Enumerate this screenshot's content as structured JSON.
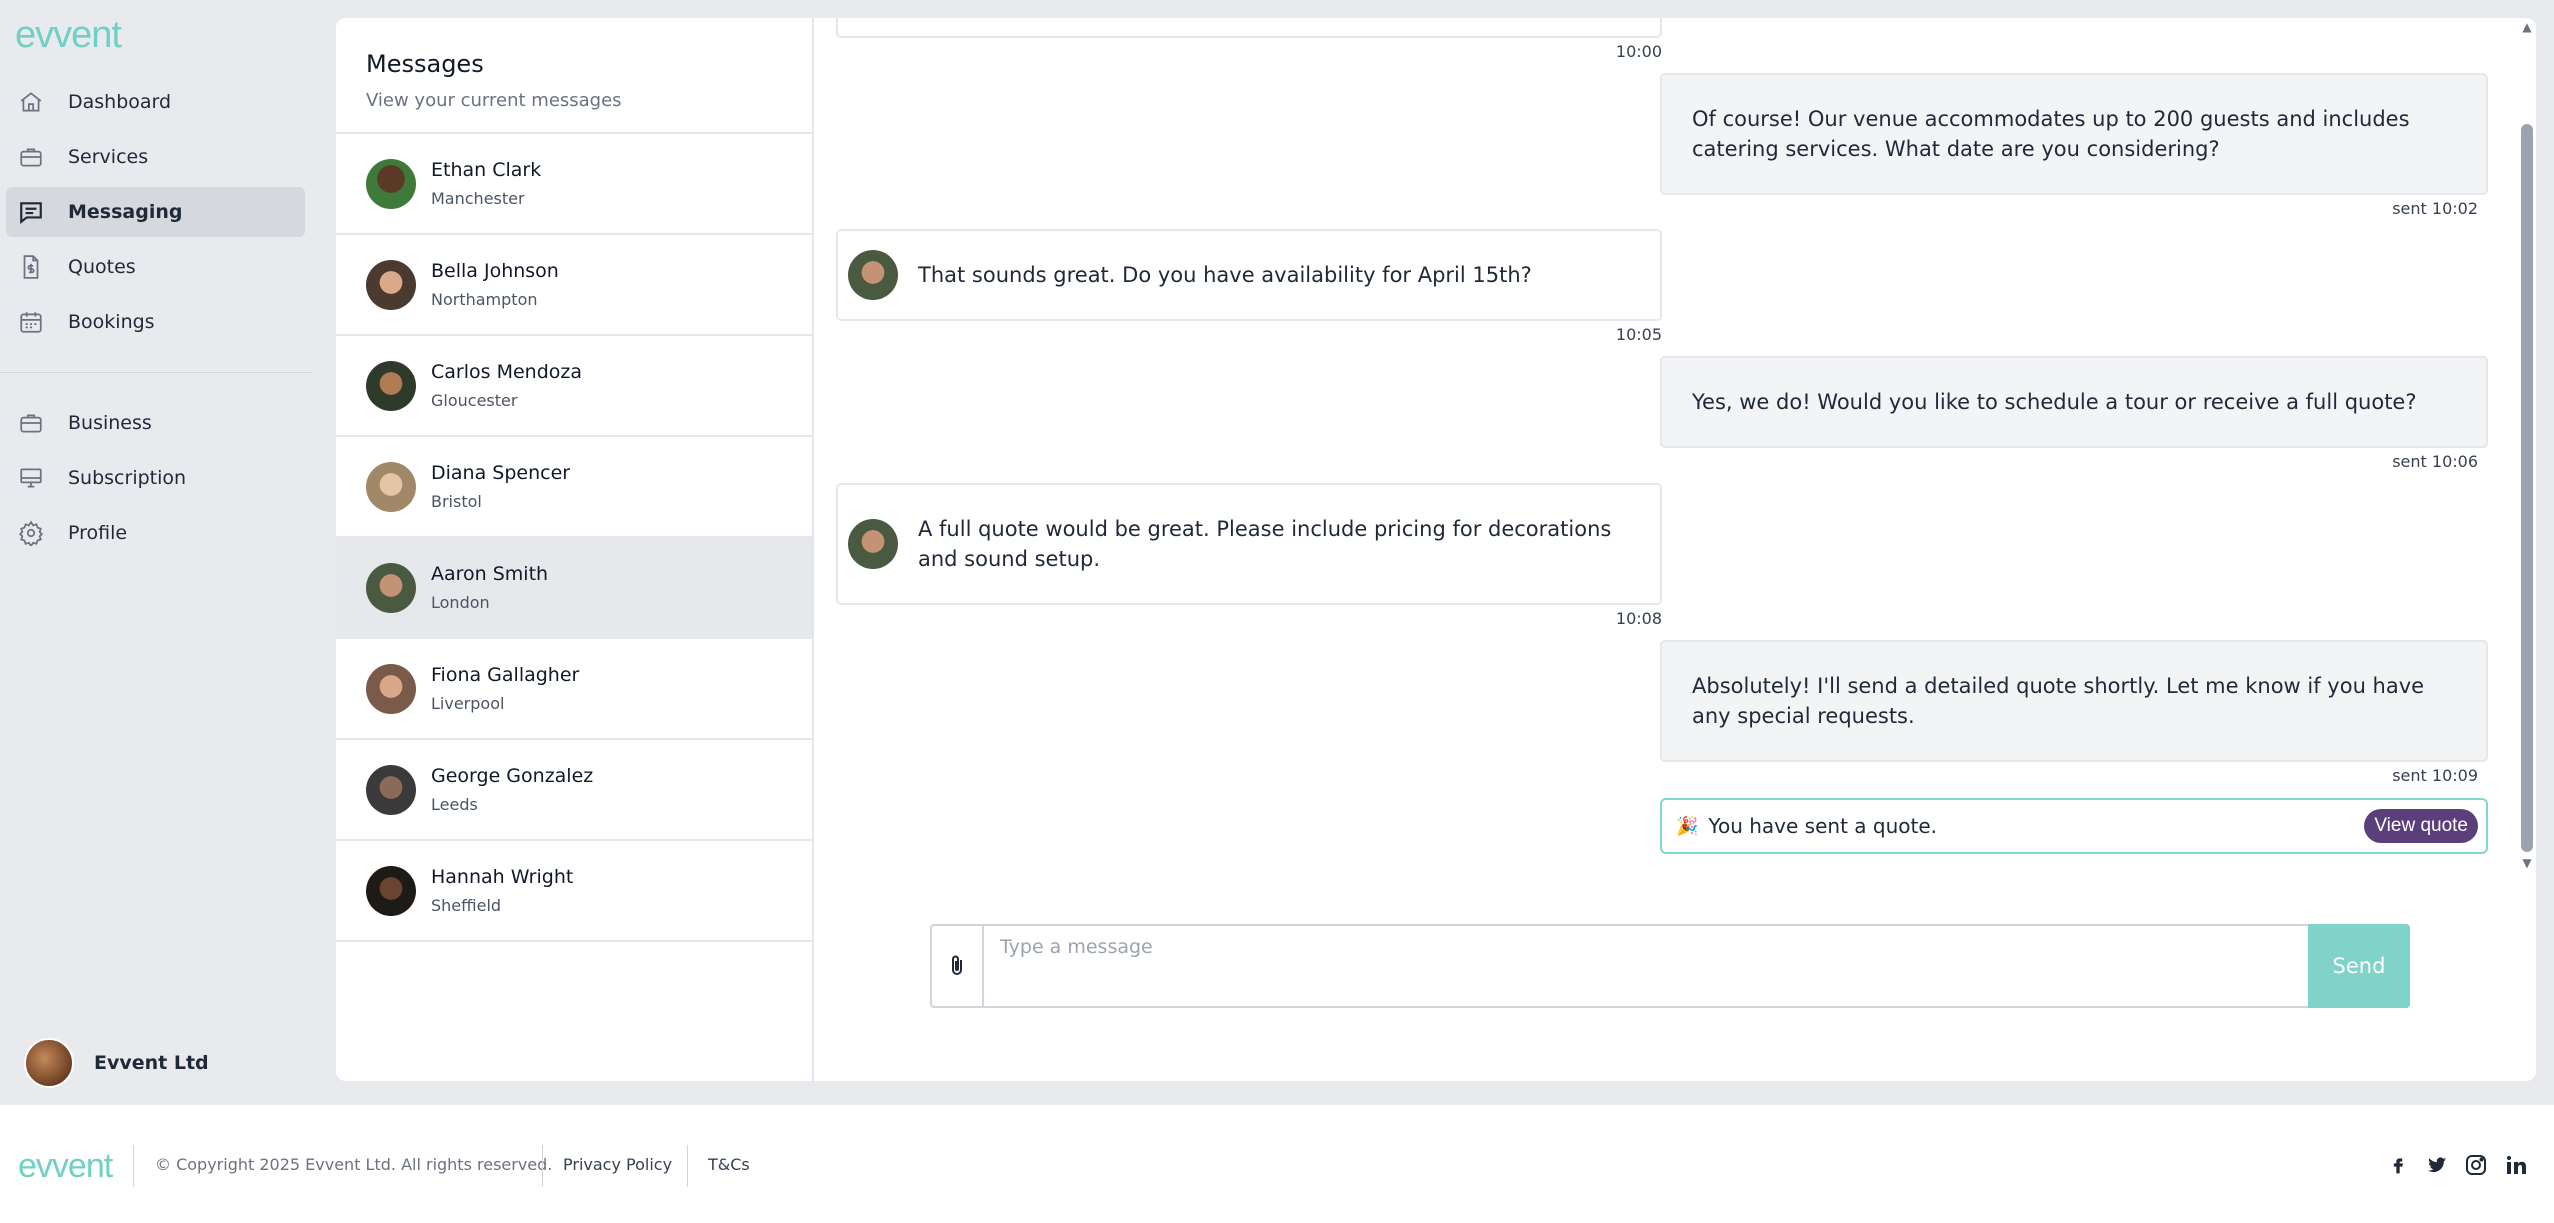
{
  "app": {
    "logo": "evvent"
  },
  "sidebar": {
    "items": [
      {
        "label": "Dashboard",
        "icon": "home-icon"
      },
      {
        "label": "Services",
        "icon": "briefcase-icon"
      },
      {
        "label": "Messaging",
        "icon": "message-icon",
        "active": true
      },
      {
        "label": "Quotes",
        "icon": "document-dollar-icon"
      },
      {
        "label": "Bookings",
        "icon": "calendar-icon"
      },
      {
        "label": "Business",
        "icon": "briefcase-icon"
      },
      {
        "label": "Subscription",
        "icon": "monitor-icon"
      },
      {
        "label": "Profile",
        "icon": "gear-icon"
      }
    ],
    "account_name": "Evvent Ltd"
  },
  "messages_panel": {
    "title": "Messages",
    "subtitle": "View your current messages",
    "conversations": [
      {
        "name": "Ethan Clark",
        "city": "Manchester"
      },
      {
        "name": "Bella Johnson",
        "city": "Northampton"
      },
      {
        "name": "Carlos Mendoza",
        "city": "Gloucester"
      },
      {
        "name": "Diana Spencer",
        "city": "Bristol"
      },
      {
        "name": "Aaron Smith",
        "city": "London",
        "active": true
      },
      {
        "name": "Fiona Gallagher",
        "city": "Liverpool"
      },
      {
        "name": "George Gonzalez",
        "city": "Leeds"
      },
      {
        "name": "Hannah Wright",
        "city": "Sheffield"
      }
    ]
  },
  "chat": {
    "messages": [
      {
        "text": "",
        "time": "10:00",
        "direction": "in"
      },
      {
        "text": "Of course! Our venue accommodates up to 200 guests and includes catering services. What date are you considering?",
        "time": "sent 10:02",
        "direction": "out"
      },
      {
        "text": "That sounds great. Do you have availability for April 15th?",
        "time": "10:05",
        "direction": "in"
      },
      {
        "text": "Yes, we do! Would you like to schedule a tour or receive a full quote?",
        "time": "sent 10:06",
        "direction": "out"
      },
      {
        "text": "A full quote would be great. Please include pricing for decorations and sound setup.",
        "time": "10:08",
        "direction": "in"
      },
      {
        "text": "Absolutely! I'll send a detailed quote shortly. Let me know if you have any special requests.",
        "time": "sent 10:09",
        "direction": "out"
      }
    ],
    "quote_notice": "You have sent a quote.",
    "quote_notice_icon": "🎉",
    "view_quote_label": "View quote",
    "composer": {
      "placeholder": "Type a message",
      "value": "",
      "send_label": "Send"
    }
  },
  "footer": {
    "logo": "evvent",
    "copyright": "© Copyright 2025 Evvent Ltd. All rights reserved.",
    "links": [
      "Privacy Policy",
      "T&Cs"
    ],
    "social": [
      "facebook-icon",
      "twitter-icon",
      "instagram-icon",
      "linkedin-icon"
    ]
  },
  "colors": {
    "brand": "#6fd0c5",
    "view_quote": "#5b3f7a",
    "send": "#7fd3c8"
  }
}
